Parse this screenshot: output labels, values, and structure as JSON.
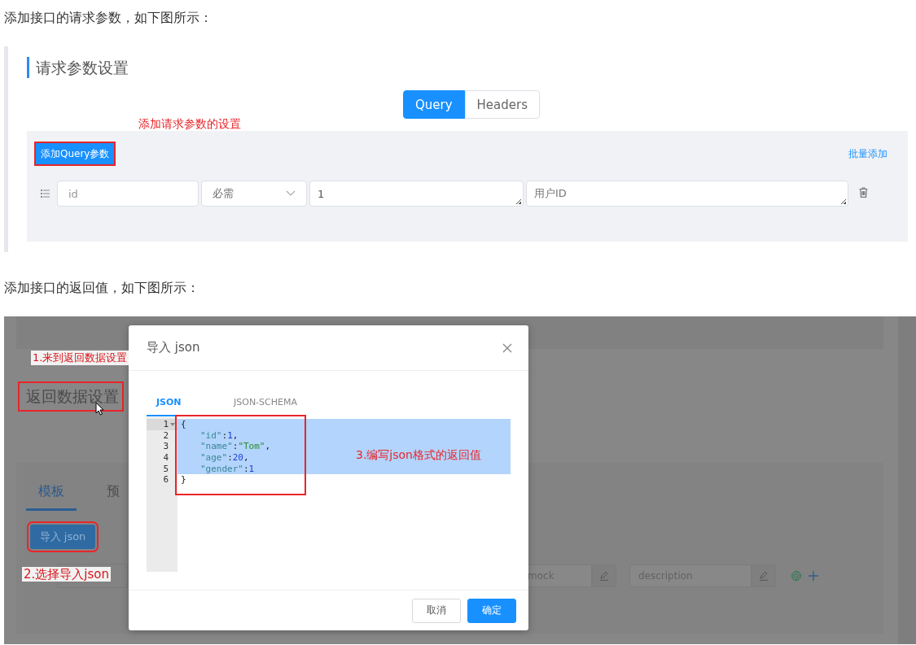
{
  "intro_1": "添加接口的请求参数，如下图所示：",
  "figure_1": {
    "heading": "请求参数设置",
    "tabs": [
      {
        "label": "Query",
        "selected": true
      },
      {
        "label": "Headers",
        "selected": false
      }
    ],
    "annotation": "添加请求参数的设置",
    "add_button": "添加Query参数",
    "bulk_add_link": "批量添加",
    "params": [
      {
        "name": "id",
        "required": "必需",
        "example": "1",
        "description": "用户ID"
      }
    ]
  },
  "intro_2": "添加接口的返回值，如下图所示：",
  "figure_2": {
    "background": {
      "annotation_1": "1.来到返回数据设置",
      "heading": "返回数据设置",
      "tabs": [
        {
          "label": "模板",
          "selected": true
        },
        {
          "label": "预",
          "selected": false
        }
      ],
      "import_button": "导入 json",
      "annotation_2": "2.选择导入json",
      "fields": [
        {
          "placeholder": "mock"
        },
        {
          "placeholder": "description"
        }
      ]
    },
    "dialog": {
      "title": "导入 json",
      "tabs": [
        {
          "label": "JSON",
          "selected": true
        },
        {
          "label": "JSON-SCHEMA",
          "selected": false
        }
      ],
      "code_lines": [
        {
          "number": "1",
          "foldable": true,
          "indented": false,
          "selected": true,
          "tokens": [
            {
              "text": "{",
              "kind": "punct"
            }
          ]
        },
        {
          "number": "2",
          "foldable": false,
          "indented": true,
          "selected": true,
          "tokens": [
            {
              "text": "\"id\"",
              "kind": "key"
            },
            {
              "text": ":",
              "kind": "punct"
            },
            {
              "text": "1",
              "kind": "number"
            },
            {
              "text": ",",
              "kind": "punct"
            }
          ]
        },
        {
          "number": "3",
          "foldable": false,
          "indented": true,
          "selected": true,
          "tokens": [
            {
              "text": "\"name\"",
              "kind": "key"
            },
            {
              "text": ":",
              "kind": "punct"
            },
            {
              "text": "\"Tom\"",
              "kind": "string"
            },
            {
              "text": ",",
              "kind": "punct"
            }
          ]
        },
        {
          "number": "4",
          "foldable": false,
          "indented": true,
          "selected": true,
          "tokens": [
            {
              "text": "\"age\"",
              "kind": "key"
            },
            {
              "text": ":",
              "kind": "punct"
            },
            {
              "text": "20",
              "kind": "number"
            },
            {
              "text": ",",
              "kind": "punct"
            }
          ]
        },
        {
          "number": "5",
          "foldable": false,
          "indented": true,
          "selected": true,
          "tokens": [
            {
              "text": "\"gender\"",
              "kind": "key"
            },
            {
              "text": ":",
              "kind": "punct"
            },
            {
              "text": "1",
              "kind": "number"
            }
          ]
        },
        {
          "number": "6",
          "foldable": false,
          "indented": false,
          "selected": false,
          "tokens": [
            {
              "text": "}",
              "kind": "punct"
            }
          ]
        }
      ],
      "annotation": "3.编写json格式的返回值",
      "buttons": [
        {
          "label": "取消",
          "kind": "default"
        },
        {
          "label": "确定",
          "kind": "primary"
        }
      ]
    }
  }
}
